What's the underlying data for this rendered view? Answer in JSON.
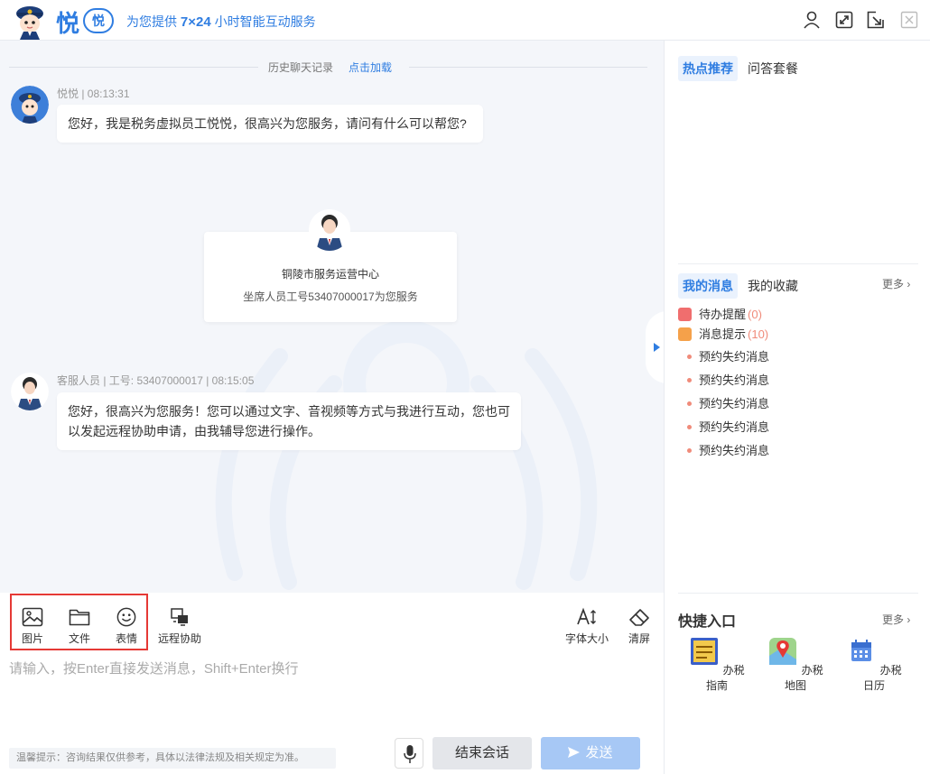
{
  "header": {
    "brand_char": "悦",
    "badge": "悦",
    "tagline_prefix": "为您提供 ",
    "tagline_bold": "7×24",
    "tagline_suffix": " 小时智能互动服务"
  },
  "chat": {
    "history_label": "历史聊天记录",
    "history_link": "点击加载",
    "messages": [
      {
        "meta": "悦悦 | 08:13:31",
        "text": "您好，我是税务虚拟员工悦悦，很高兴为您服务，请问有什么可以帮您?"
      },
      {
        "meta": "客服人员 | 工号: 53407000017 | 08:15:05",
        "text_line1": "您好，很高兴为您服务！您可以通过文字、音视频等方式与我进行互动，您也可",
        "text_line2": "以发起远程协助申请，由我辅导您进行操作。"
      }
    ],
    "agent_card": {
      "org": "铜陵市服务运营中心",
      "desc": "坐席人员工号53407000017为您服务"
    }
  },
  "toolbar": {
    "image": "图片",
    "file": "文件",
    "emoji": "表情",
    "remote": "远程协助",
    "font_size": "字体大小",
    "clear": "清屏"
  },
  "input": {
    "placeholder": "请输入，按Enter直接发送消息，Shift+Enter换行",
    "tip": "温馨提示：咨询结果仅供参考，具体以法律法规及相关规定为准。",
    "end_label": "结束会话",
    "send_label": "发送"
  },
  "right_panel": {
    "tabs_top": [
      "热点推荐",
      "问答套餐"
    ],
    "tabs_mid": [
      "我的消息",
      "我的收藏"
    ],
    "more": "更多",
    "notices": [
      {
        "label": "待办提醒",
        "count": "(0)",
        "color": "#f06e6e"
      },
      {
        "label": "消息提示",
        "count": "(10)",
        "color": "#f5a14a"
      }
    ],
    "message_items": [
      "预约失约消息",
      "预约失约消息",
      "预约失约消息",
      "预约失约消息",
      "预约失约消息"
    ],
    "quick_title": "快捷入口",
    "quick_more": "更多",
    "quick_items": [
      "办税指南",
      "办税地图",
      "办税日历"
    ]
  },
  "colors": {
    "accent": "#2f7de1",
    "highlight": "#e53935",
    "send_disabled": "#a7c8f5"
  }
}
